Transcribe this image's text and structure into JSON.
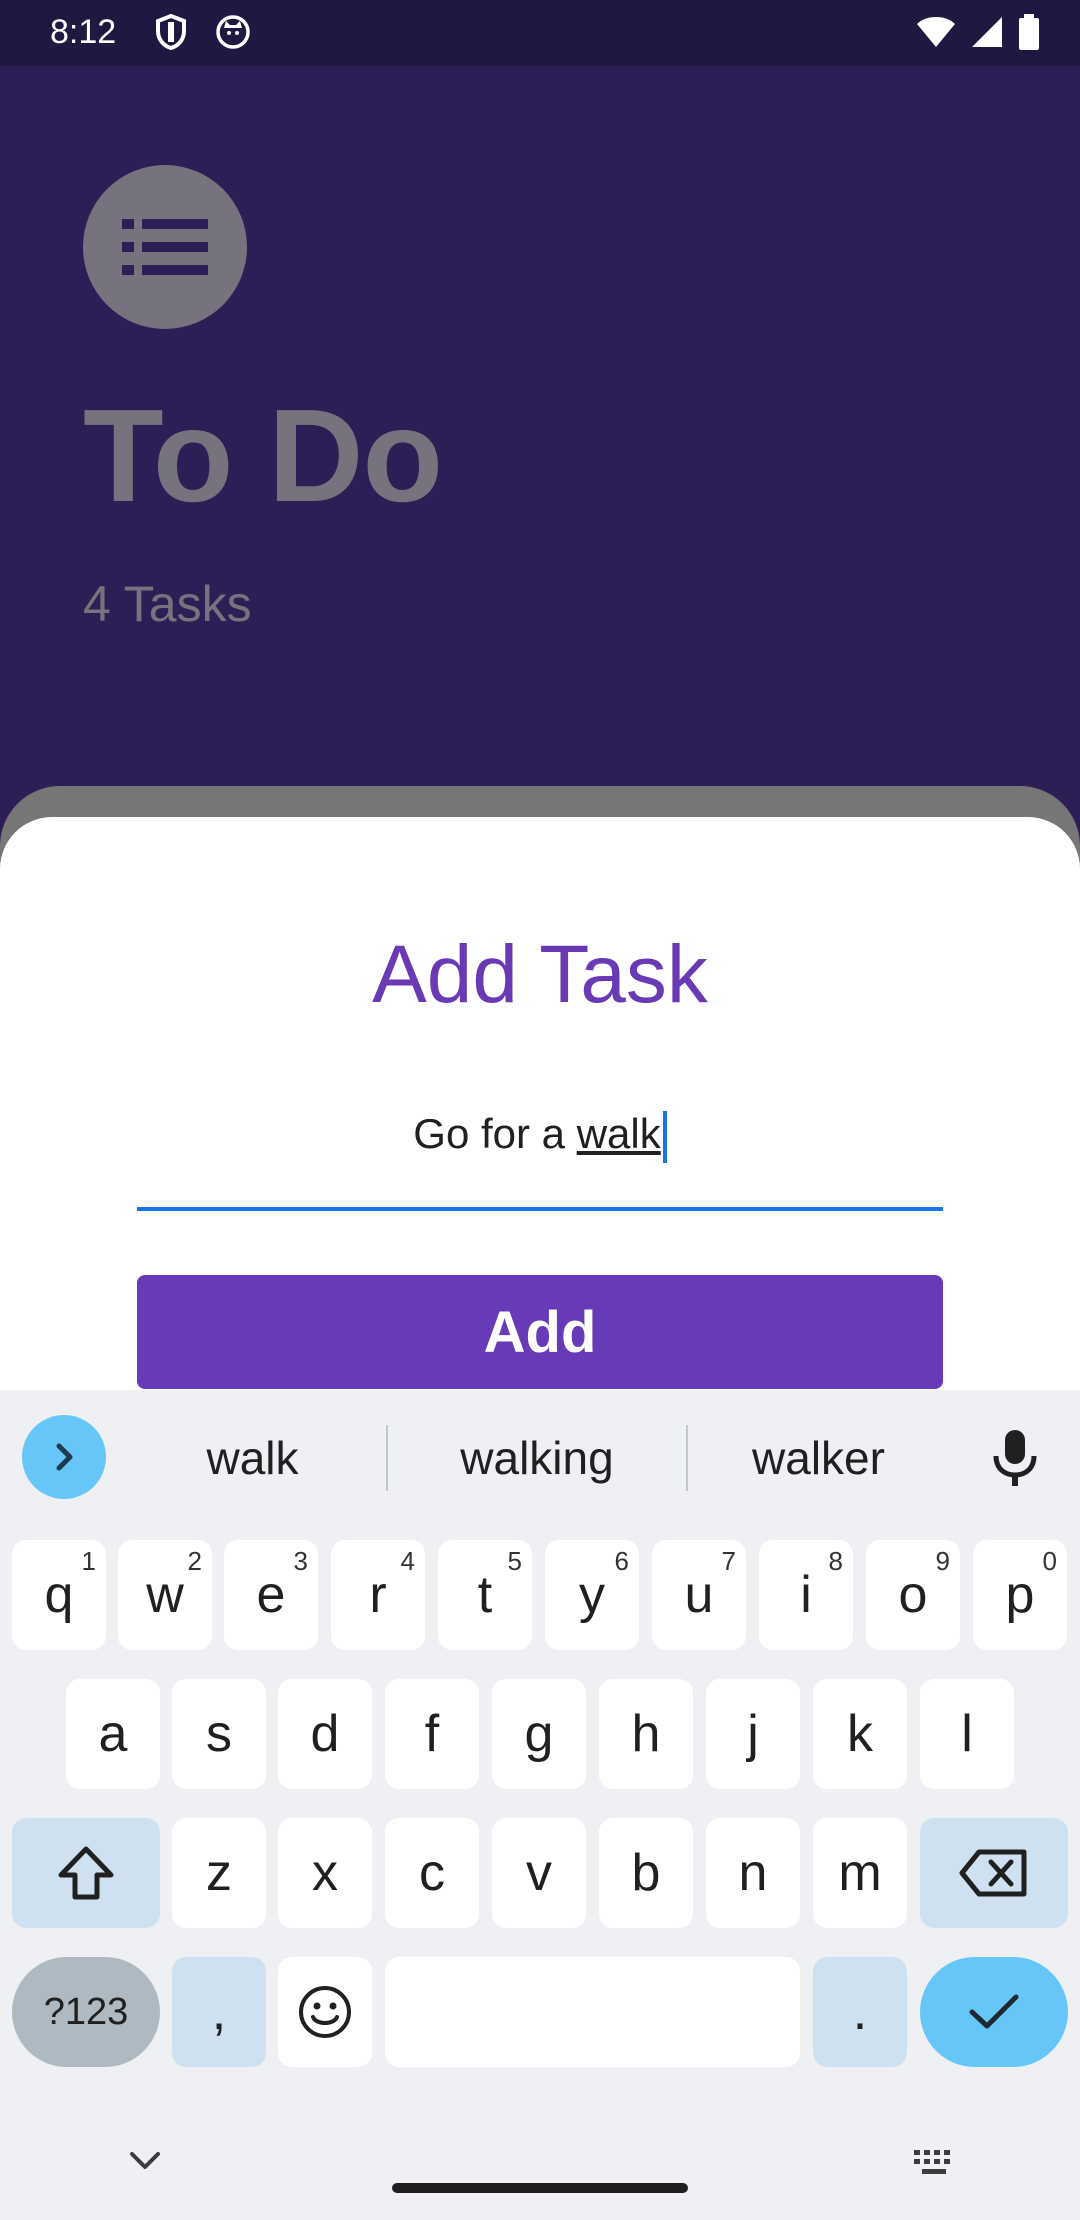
{
  "status_bar": {
    "time": "8:12"
  },
  "background_app": {
    "title": "To Do",
    "task_count": "4 Tasks"
  },
  "dialog": {
    "title": "Add Task",
    "input_prefix": "Go for a ",
    "input_underlined_word": "walk",
    "add_button_label": "Add"
  },
  "keyboard": {
    "suggestions": [
      "walk",
      "walking",
      "walker"
    ],
    "row1": [
      {
        "letter": "q",
        "num": "1"
      },
      {
        "letter": "w",
        "num": "2"
      },
      {
        "letter": "e",
        "num": "3"
      },
      {
        "letter": "r",
        "num": "4"
      },
      {
        "letter": "t",
        "num": "5"
      },
      {
        "letter": "y",
        "num": "6"
      },
      {
        "letter": "u",
        "num": "7"
      },
      {
        "letter": "i",
        "num": "8"
      },
      {
        "letter": "o",
        "num": "9"
      },
      {
        "letter": "p",
        "num": "0"
      }
    ],
    "row2": [
      "a",
      "s",
      "d",
      "f",
      "g",
      "h",
      "j",
      "k",
      "l"
    ],
    "row3": [
      "z",
      "x",
      "c",
      "v",
      "b",
      "n",
      "m"
    ],
    "symbols_label": "?123",
    "comma_label": ",",
    "period_label": "."
  },
  "colors": {
    "accent": "#673ab7",
    "title_purple": "#6a3ab5",
    "input_blue": "#1a73e8",
    "enter_key": "#66c6f7"
  }
}
